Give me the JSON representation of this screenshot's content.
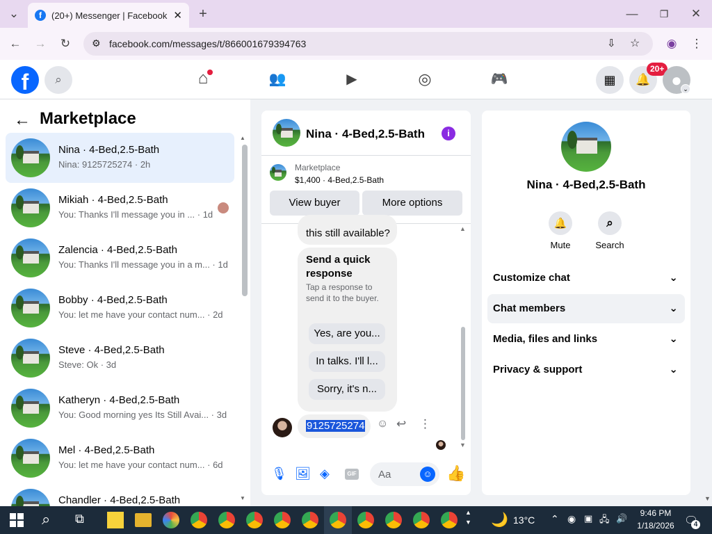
{
  "browser": {
    "tab_title": "(20+) Messenger | Facebook",
    "url": "facebook.com/messages/t/866001679394763"
  },
  "header": {
    "notifications_badge": "20+"
  },
  "sidebar": {
    "title": "Marketplace",
    "conversations": [
      {
        "name": "Nina · 4-Bed,2.5-Bath",
        "preview": "Nina: 9125725274 · 2h",
        "selected": true
      },
      {
        "name": "Mikiah · 4-Bed,2.5-Bath",
        "preview": "You: Thanks I'll message you in ... · 1d"
      },
      {
        "name": "Zalencia · 4-Bed,2.5-Bath",
        "preview": "You: Thanks I'll message you in a m... · 1d"
      },
      {
        "name": "Bobby · 4-Bed,2.5-Bath",
        "preview": "You: let me have your contact num... · 2d"
      },
      {
        "name": "Steve · 4-Bed,2.5-Bath",
        "preview": "Steve: Ok · 3d"
      },
      {
        "name": "Katheryn · 4-Bed,2.5-Bath",
        "preview": "You: Good morning yes Its Still Avai... · 3d"
      },
      {
        "name": "Mel · 4-Bed,2.5-Bath",
        "preview": "You: let me have your contact num... · 6d"
      },
      {
        "name": "Chandler · 4-Bed,2.5-Bath",
        "preview": ""
      }
    ]
  },
  "chat": {
    "title": "Nina · 4-Bed,2.5-Bath",
    "listing_source": "Marketplace",
    "listing_price": "$1,400 · 4-Bed,2.5-Bath",
    "view_buyer": "View buyer",
    "more_options": "More options",
    "prev_message_tail": "this still available?",
    "quick_title": "Send a quick response",
    "quick_sub": "Tap a response to send it to the buyer.",
    "quick_replies": [
      "Yes, are you...",
      "In talks. I'll l...",
      "Sorry, it's n..."
    ],
    "last_message": "9125725274",
    "input_placeholder": "Aa"
  },
  "info": {
    "name": "Nina · 4-Bed,2.5-Bath",
    "mute": "Mute",
    "search": "Search",
    "options": [
      "Customize chat",
      "Chat members",
      "Media, files and links",
      "Privacy & support"
    ]
  },
  "taskbar": {
    "weather": "13°C",
    "time": "9:46 PM",
    "date": "1/18/2026",
    "notif_count": "4"
  },
  "colors": {
    "fb_blue": "#0866ff",
    "selected_bg": "#e7f0fd",
    "purple_info": "#8a2be2"
  }
}
